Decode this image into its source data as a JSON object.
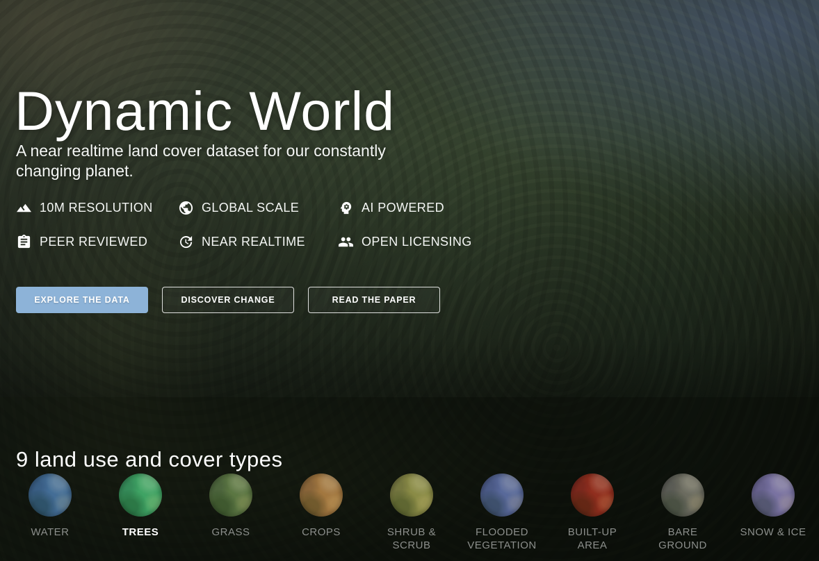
{
  "hero": {
    "title": "Dynamic World",
    "subtitle": "A near realtime land cover dataset for our constantly changing planet.",
    "accent_color": "#8db3d8",
    "features": [
      {
        "icon": "terrain-icon",
        "label": "10M RESOLUTION"
      },
      {
        "icon": "globe-icon",
        "label": "GLOBAL SCALE"
      },
      {
        "icon": "ai-brain-icon",
        "label": "AI POWERED"
      },
      {
        "icon": "clipboard-icon",
        "label": "PEER REVIEWED"
      },
      {
        "icon": "update-clock-icon",
        "label": "NEAR REALTIME"
      },
      {
        "icon": "people-icon",
        "label": "OPEN LICENSING"
      }
    ],
    "buttons": {
      "explore": "EXPLORE THE DATA",
      "discover": "DISCOVER CHANGE",
      "paper": "READ THE PAPER"
    }
  },
  "land_cover_section": {
    "heading": "9 land use and cover types",
    "active_type": "TREES",
    "types": [
      {
        "label": "WATER",
        "lines": [
          "WATER"
        ],
        "color": "#46719c"
      },
      {
        "label": "TREES",
        "lines": [
          "TREES"
        ],
        "color": "#3fa364",
        "active": true
      },
      {
        "label": "GRASS",
        "lines": [
          "GRASS"
        ],
        "color": "#5e7a45"
      },
      {
        "label": "CROPS",
        "lines": [
          "CROPS"
        ],
        "color": "#a87b42"
      },
      {
        "label": "SHRUB & SCRUB",
        "lines": [
          "SHRUB &",
          "SCRUB"
        ],
        "color": "#8f9049"
      },
      {
        "label": "FLOODED VEGETATION",
        "lines": [
          "FLOODED",
          "VEGETATION"
        ],
        "color": "#5c6da0"
      },
      {
        "label": "BUILT-UP AREA",
        "lines": [
          "BUILT-UP",
          "AREA"
        ],
        "color": "#96301f"
      },
      {
        "label": "BARE GROUND",
        "lines": [
          "BARE",
          "GROUND"
        ],
        "color": "#6f6f63"
      },
      {
        "label": "SNOW & ICE",
        "lines": [
          "SNOW & ICE"
        ],
        "color": "#7e77a8"
      }
    ]
  }
}
